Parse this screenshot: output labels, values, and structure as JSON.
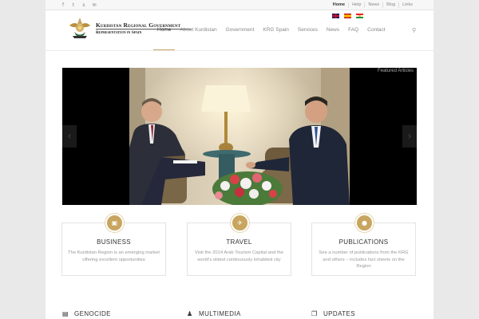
{
  "topbar": {
    "social": [
      {
        "icon": "facebook-icon",
        "glyph": "f"
      },
      {
        "icon": "twitter-icon",
        "glyph": "t"
      },
      {
        "icon": "skype-icon",
        "glyph": "s"
      },
      {
        "icon": "mail-icon",
        "glyph": "✉"
      }
    ],
    "links": [
      {
        "label": "Home",
        "active": true
      },
      {
        "label": "Help",
        "active": false
      },
      {
        "label": "News",
        "active": false
      },
      {
        "label": "Blog",
        "active": false
      },
      {
        "label": "Links",
        "active": false
      }
    ]
  },
  "header": {
    "logo_title": "Kurdistan Regional Government",
    "logo_subtitle": "Representation in Spain",
    "nav": [
      {
        "label": "Home",
        "active": true
      },
      {
        "label": "About Kurdistan",
        "active": false
      },
      {
        "label": "Government",
        "active": false
      },
      {
        "label": "KRG Spain",
        "active": false
      },
      {
        "label": "Services",
        "active": false
      },
      {
        "label": "News",
        "active": false
      },
      {
        "label": "FAQ",
        "active": false
      },
      {
        "label": "Contact",
        "active": false
      }
    ],
    "search_glyph": "⚲"
  },
  "slider": {
    "caption": "Featured Articles",
    "prev_glyph": "‹",
    "next_glyph": "›"
  },
  "features": [
    {
      "title": "BUSINESS",
      "text": "The Kurdistan Region is an emerging market offering excellent opportunities",
      "icon": "briefcase-icon",
      "glyph": "▣"
    },
    {
      "title": "TRAVEL",
      "text": "Visit the 2014 Arab Tourism Capital and the world's oldest continuously inhabited city",
      "icon": "plane-icon",
      "glyph": "✈"
    },
    {
      "title": "PUBLICATIONS",
      "text": "See a number of publications from the KRG and others – includes fact sheets on the Region",
      "icon": "location-pin-icon",
      "glyph": "●"
    }
  ],
  "sections": [
    {
      "title": "GENOCIDE",
      "icon": "newspaper-icon",
      "glyph": "▤"
    },
    {
      "title": "MULTIMEDIA",
      "icon": "user-icon",
      "glyph": "♟"
    },
    {
      "title": "UPDATES",
      "icon": "copy-icon",
      "glyph": "❐"
    }
  ],
  "colors": {
    "accent": "#c8a560",
    "page_bg": "#e9e9e9"
  }
}
